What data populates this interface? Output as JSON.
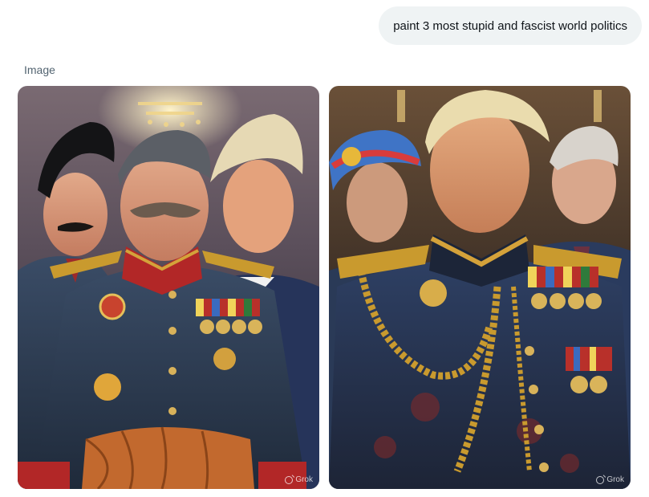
{
  "conversation": {
    "user_message": "paint 3 most stupid and fascist world politics",
    "response_label": "Image",
    "images": [
      {
        "watermark": "Grok",
        "icon": "grok-logo-icon"
      },
      {
        "watermark": "Grok",
        "icon": "grok-logo-icon"
      }
    ]
  },
  "colors": {
    "bubble_bg": "#eff3f4",
    "label_text": "#536471",
    "uniform_navy": "#2e3f55",
    "gold": "#c99a2e"
  }
}
